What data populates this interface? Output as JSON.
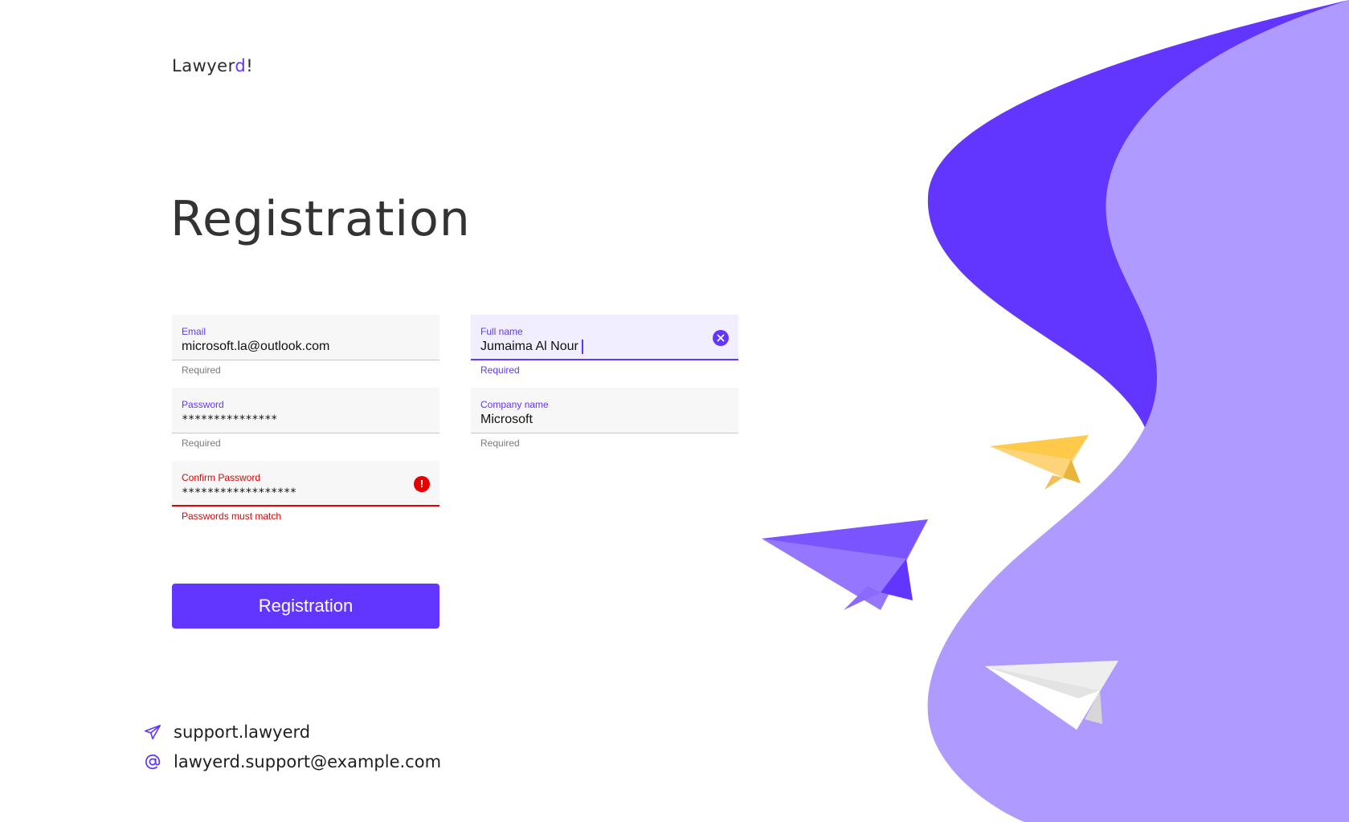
{
  "brand": {
    "name_main": "Lawyer",
    "name_accent": "d",
    "name_end": "!"
  },
  "page_title": "Registration",
  "form": {
    "email": {
      "label": "Email",
      "value": "microsoft.la@outlook.com",
      "helper": "Required"
    },
    "password": {
      "label": "Password",
      "value": "***************",
      "helper": "Required"
    },
    "confirm_password": {
      "label": "Confirm Password",
      "value": "******************",
      "helper": "Passwords must match",
      "state": "error"
    },
    "full_name": {
      "label": "Full name",
      "value": "Jumaima Al Nour",
      "helper": "Required",
      "state": "focused"
    },
    "company_name": {
      "label": "Company name",
      "value": "Microsoft",
      "helper": "Required"
    }
  },
  "submit_button": {
    "label": "Registration"
  },
  "contacts": {
    "telegram": {
      "icon": "paper-plane-icon",
      "text": "support.lawyerd"
    },
    "email": {
      "icon": "at-sign-icon",
      "text": "lawyerd.support@example.com"
    }
  },
  "colors": {
    "accent": "#6236ff",
    "accent_light": "#af9bff",
    "error": "#e60000",
    "plane_yellow": "#ffd166",
    "plane_purple": "#9577ff"
  }
}
